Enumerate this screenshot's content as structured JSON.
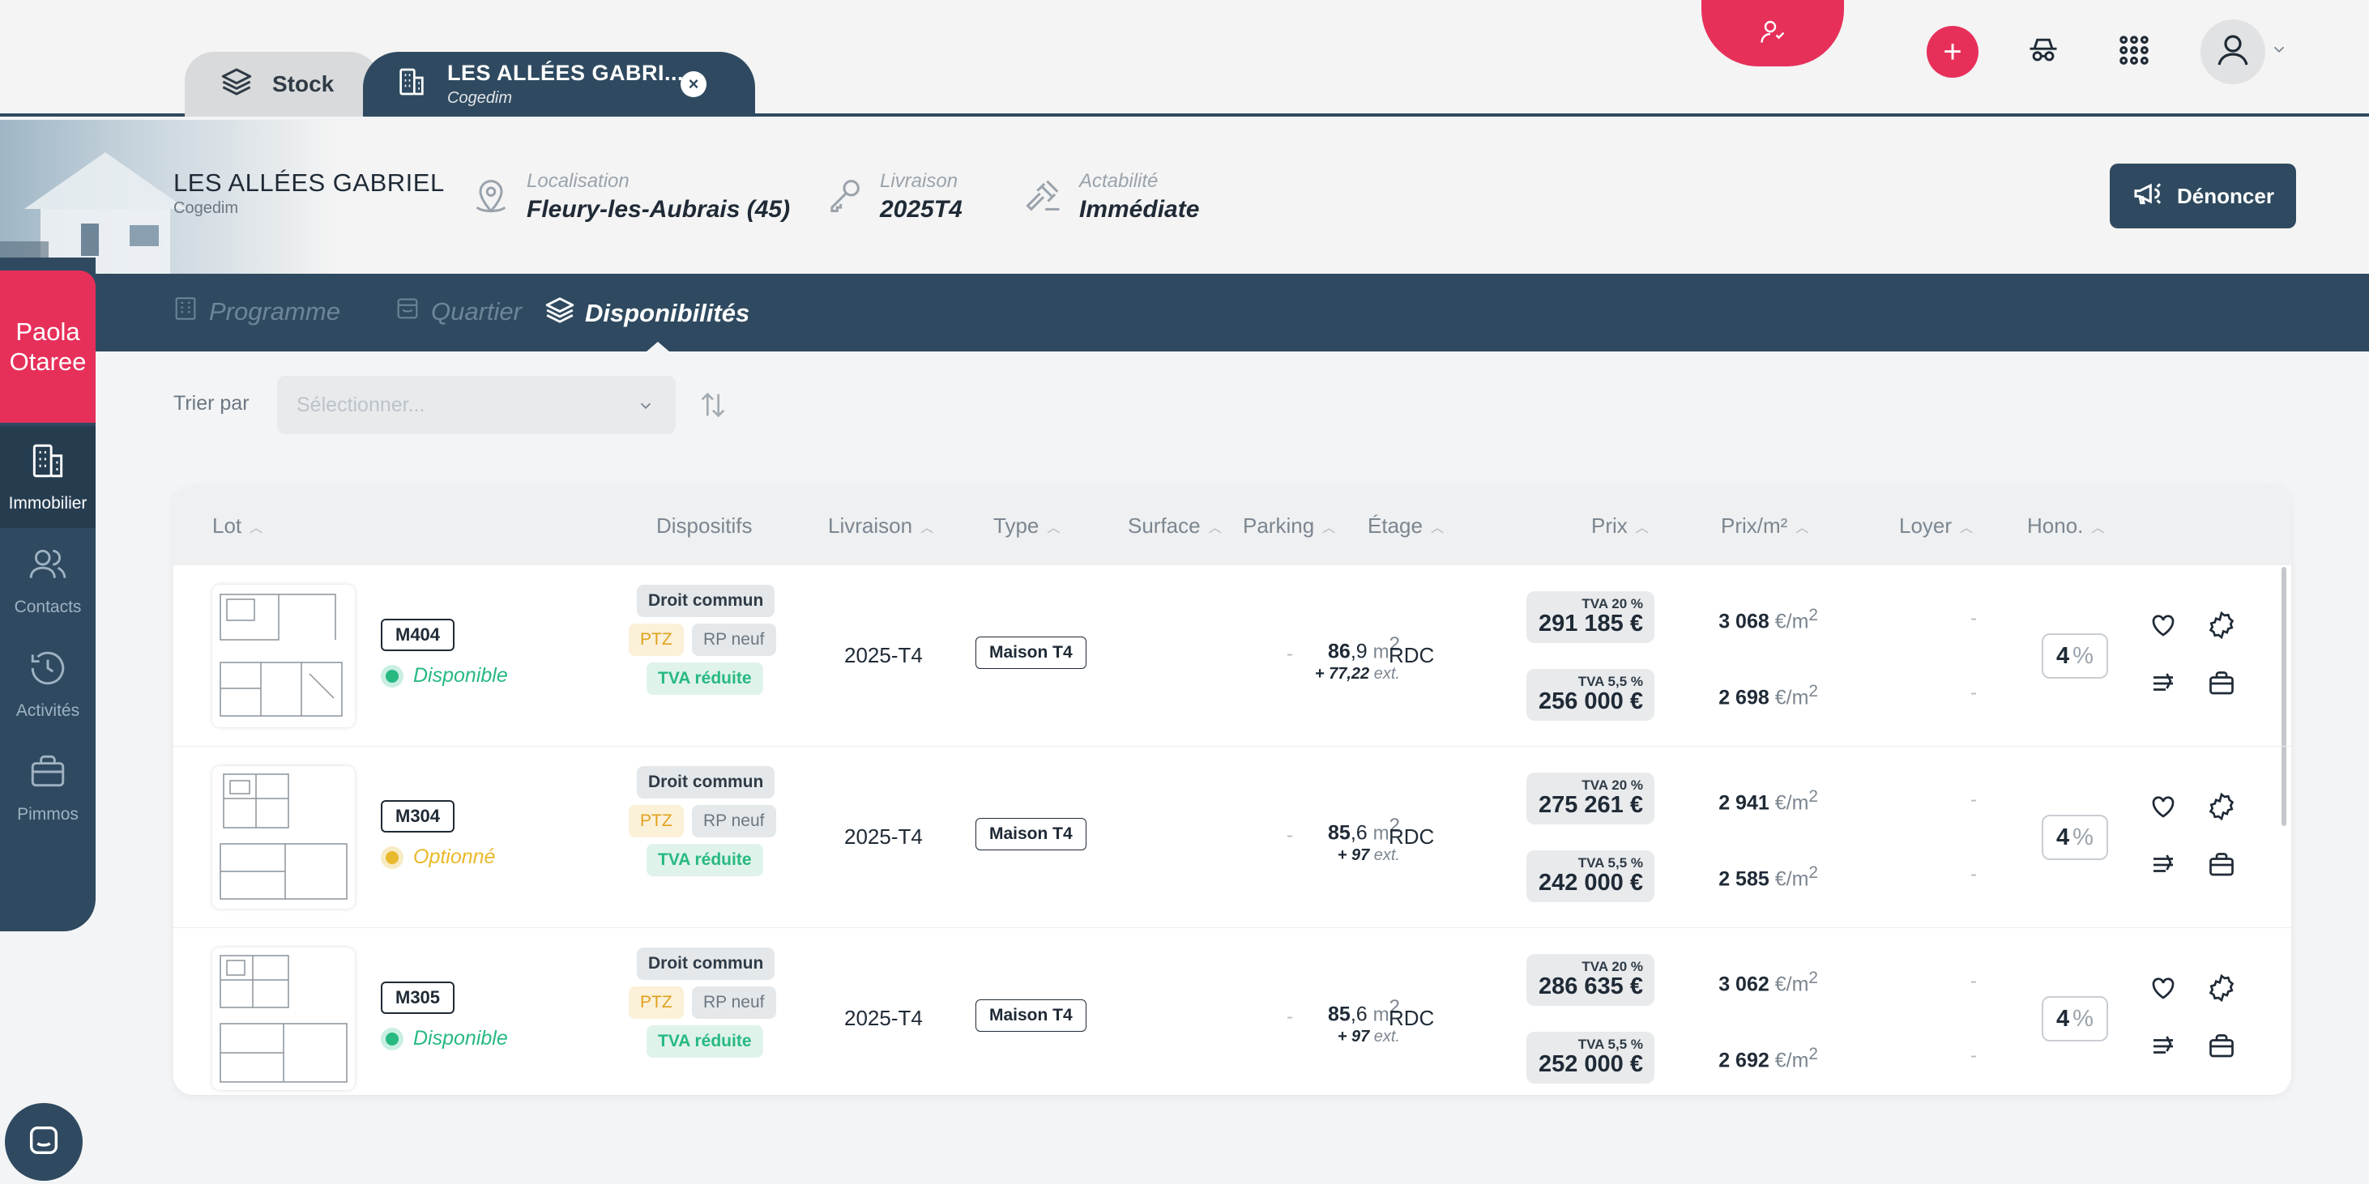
{
  "tabs": {
    "stock_label": "Stock",
    "active_title": "LES ALLÉES GABRI...",
    "active_subtitle": "Cogedim",
    "close_symbol": "×"
  },
  "header": {
    "program_name": "LES ALLÉES GABRIEL",
    "program_developer": "Cogedim",
    "localisation_label": "Localisation",
    "localisation_value": "Fleury-les-Aubrais (45)",
    "livraison_label": "Livraison",
    "livraison_value": "2025T4",
    "actabilite_label": "Actabilité",
    "actabilite_value": "Immédiate",
    "denoncer_label": "Dénoncer"
  },
  "nav": {
    "programme": "Programme",
    "quartier": "Quartier",
    "disponibilites": "Disponibilités"
  },
  "sidebar": {
    "user_first": "Paola",
    "user_last": "Otaree",
    "items": [
      {
        "label": "Immobilier",
        "icon": "building-icon"
      },
      {
        "label": "Contacts",
        "icon": "users-icon"
      },
      {
        "label": "Activités",
        "icon": "history-icon"
      },
      {
        "label": "Pimmos",
        "icon": "briefcase-icon"
      }
    ]
  },
  "sort": {
    "label": "Trier par",
    "placeholder": "Sélectionner..."
  },
  "columns": {
    "lot": "Lot",
    "dispositifs": "Dispositifs",
    "livraison": "Livraison",
    "type": "Type",
    "surface": "Surface",
    "parking": "Parking",
    "etage": "Étage",
    "prix": "Prix",
    "prix_m2": "Prix/m²",
    "loyer": "Loyer",
    "hono": "Hono."
  },
  "rows": [
    {
      "lot": "M404",
      "status": "Disponible",
      "dispositifs": {
        "commun": "Droit commun",
        "ptz": "PTZ",
        "rp": "RP neuf",
        "tva": "TVA réduite"
      },
      "livraison": "2025-T4",
      "type": "Maison T4",
      "surface_int": "86",
      "surface_dec": ",9",
      "surface_unit": "m",
      "surface_ext": "+ 77,22",
      "ext_label": "ext.",
      "parking": "-",
      "etage": "RDC",
      "tva1": "TVA 20 %",
      "prix1": "291 185 €",
      "tva2": "TVA 5,5 %",
      "prix2": "256 000 €",
      "ppm1": "3 068",
      "ppm2": "2 698",
      "ppm_unit": "€/m",
      "loyer1": "-",
      "loyer2": "-",
      "hono_value": "4",
      "hono_unit": "%"
    },
    {
      "lot": "M304",
      "status": "Optionné",
      "dispositifs": {
        "commun": "Droit commun",
        "ptz": "PTZ",
        "rp": "RP neuf",
        "tva": "TVA réduite"
      },
      "livraison": "2025-T4",
      "type": "Maison T4",
      "surface_int": "85",
      "surface_dec": ",6",
      "surface_unit": "m",
      "surface_ext": "+ 97",
      "ext_label": "ext.",
      "parking": "-",
      "etage": "RDC",
      "tva1": "TVA 20 %",
      "prix1": "275 261 €",
      "tva2": "TVA 5,5 %",
      "prix2": "242 000 €",
      "ppm1": "2 941",
      "ppm2": "2 585",
      "ppm_unit": "€/m",
      "loyer1": "-",
      "loyer2": "-",
      "hono_value": "4",
      "hono_unit": "%"
    },
    {
      "lot": "M305",
      "status": "Disponible",
      "dispositifs": {
        "commun": "Droit commun",
        "ptz": "PTZ",
        "rp": "RP neuf",
        "tva": "TVA réduite"
      },
      "livraison": "2025-T4",
      "type": "Maison T4",
      "surface_int": "85",
      "surface_dec": ",6",
      "surface_unit": "m",
      "surface_ext": "+ 97",
      "ext_label": "ext.",
      "parking": "-",
      "etage": "RDC",
      "tva1": "TVA 20 %",
      "prix1": "286 635 €",
      "tva2": "TVA 5,5 %",
      "prix2": "252 000 €",
      "ppm1": "3 062",
      "ppm2": "2 692",
      "ppm_unit": "€/m",
      "loyer1": "-",
      "loyer2": "-",
      "hono_value": "4",
      "hono_unit": "%"
    }
  ],
  "colors": {
    "accent": "#e6305a",
    "navy": "#2f4a60",
    "available": "#27b981",
    "optioned": "#e9b92c"
  }
}
